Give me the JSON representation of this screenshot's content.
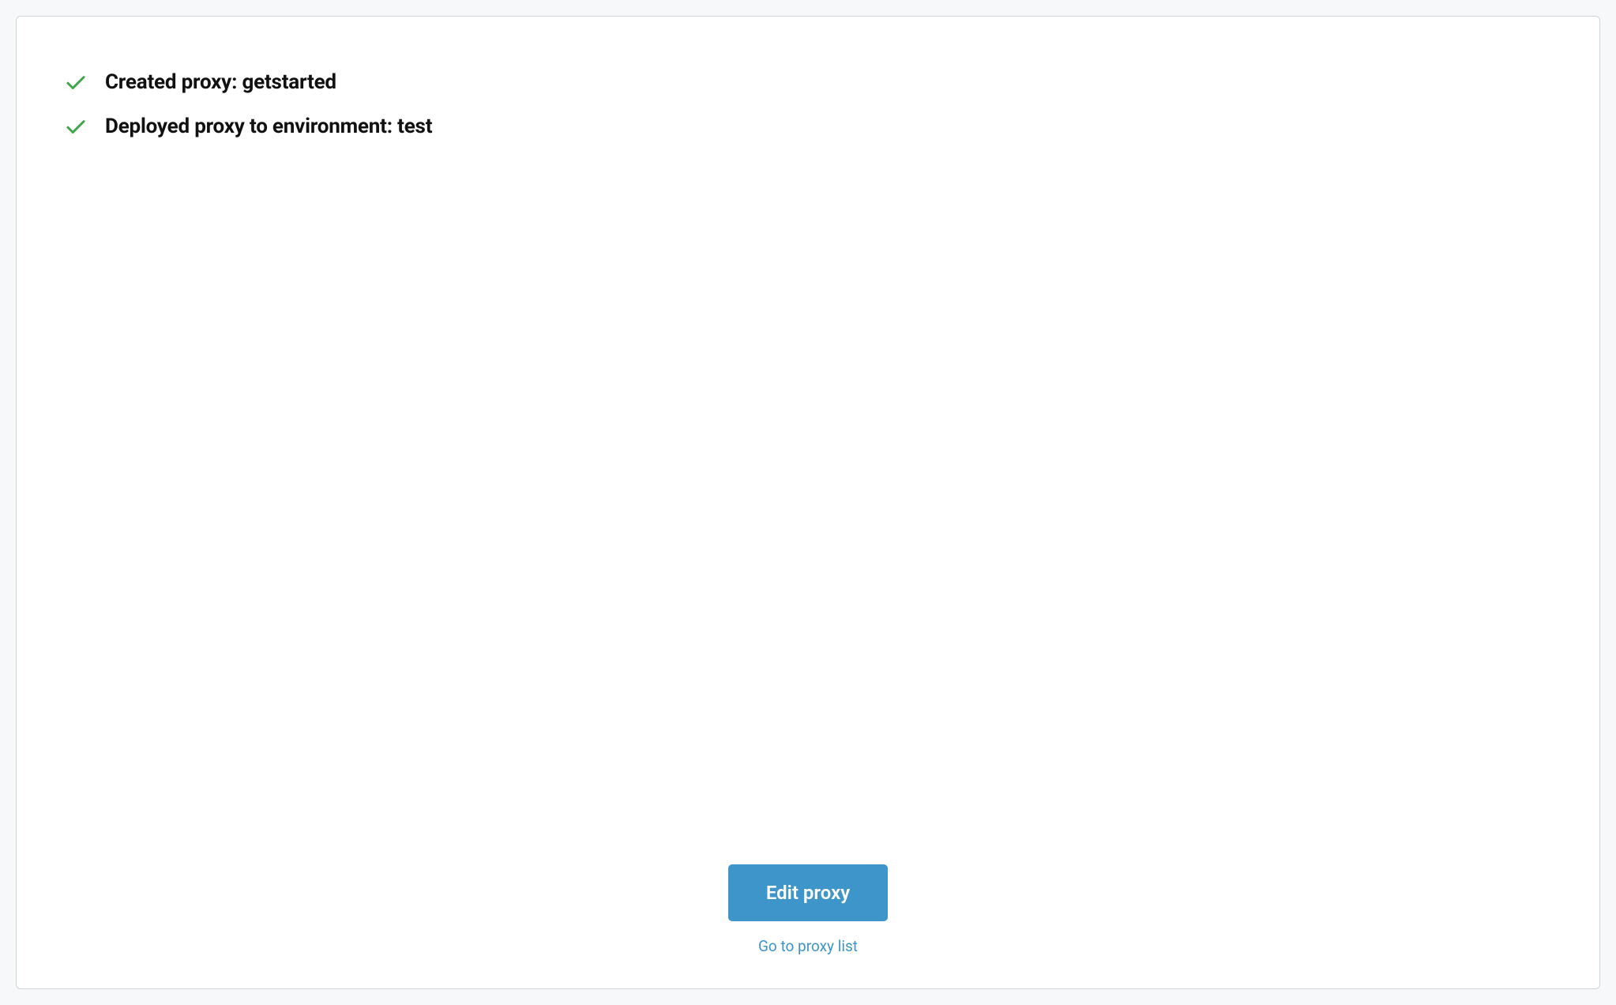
{
  "status": {
    "items": [
      {
        "text": "Created proxy: getstarted"
      },
      {
        "text": "Deployed proxy to environment: test"
      }
    ]
  },
  "footer": {
    "primary_button_label": "Edit proxy",
    "secondary_link_label": "Go to proxy list"
  }
}
